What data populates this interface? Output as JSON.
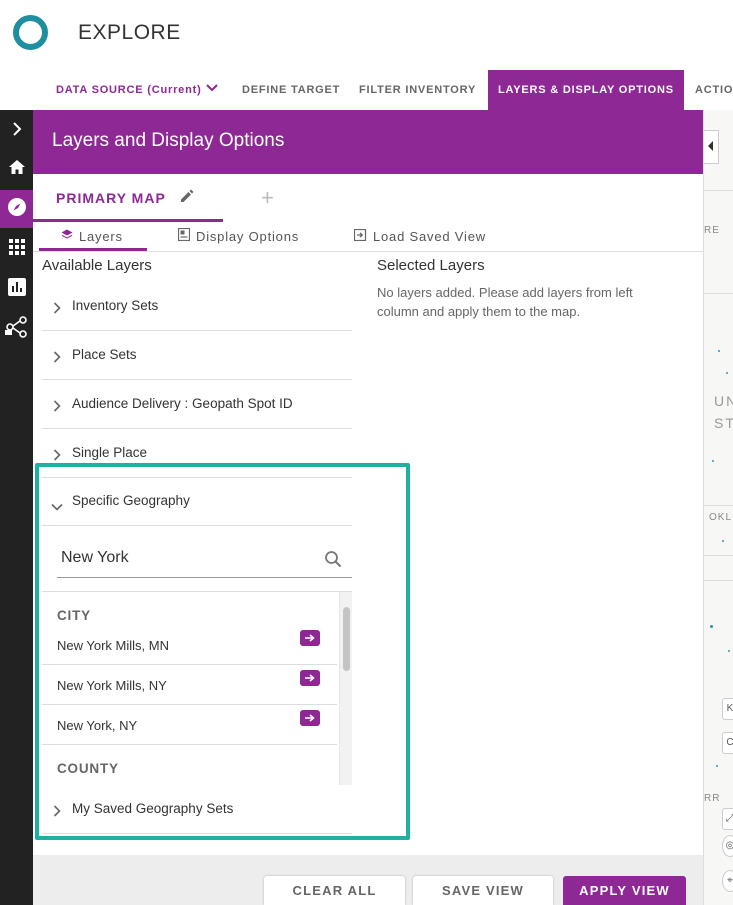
{
  "app": {
    "title": "EXPLORE"
  },
  "nav_tabs": [
    {
      "label": "DATA SOURCE (Current)"
    },
    {
      "label": "DEFINE TARGET"
    },
    {
      "label": "FILTER INVENTORY"
    },
    {
      "label": "LAYERS & DISPLAY OPTIONS"
    },
    {
      "label": "ACTIO"
    }
  ],
  "panel": {
    "title": "Layers and Display Options",
    "map_tab": "PRIMARY MAP",
    "add_tab_symbol": "+",
    "subtabs": [
      {
        "label": "Layers"
      },
      {
        "label": "Display Options"
      },
      {
        "label": "Load Saved View"
      }
    ]
  },
  "available": {
    "title": "Available Layers",
    "items": [
      {
        "label": "Inventory Sets"
      },
      {
        "label": "Place Sets"
      },
      {
        "label": "Audience Delivery : Geopath Spot ID"
      },
      {
        "label": "Single Place"
      },
      {
        "label": "Specific Geography"
      },
      {
        "label": "My Saved Geography Sets"
      }
    ]
  },
  "search": {
    "value": "New York"
  },
  "results": {
    "groups": [
      {
        "label": "CITY"
      },
      {
        "label": "COUNTY"
      }
    ],
    "city_items": [
      {
        "label": "New York Mills, MN"
      },
      {
        "label": "New York Mills, NY"
      },
      {
        "label": "New York, NY"
      }
    ]
  },
  "selected": {
    "title": "Selected Layers",
    "empty_message": "No layers added. Please add layers from left column and apply them to the map."
  },
  "footer": {
    "clear_all": "CLEAR ALL",
    "save_view": "SAVE VIEW",
    "apply_view": "APPLY VIEW"
  },
  "map": {
    "labels": [
      "RE",
      "UN",
      "ST",
      "OKL",
      "K",
      "C",
      "RR"
    ]
  },
  "colors": {
    "accent": "#8e2895",
    "logo": "#1e8fa0",
    "highlight": "#1fb0a0",
    "rail": "#222222"
  }
}
